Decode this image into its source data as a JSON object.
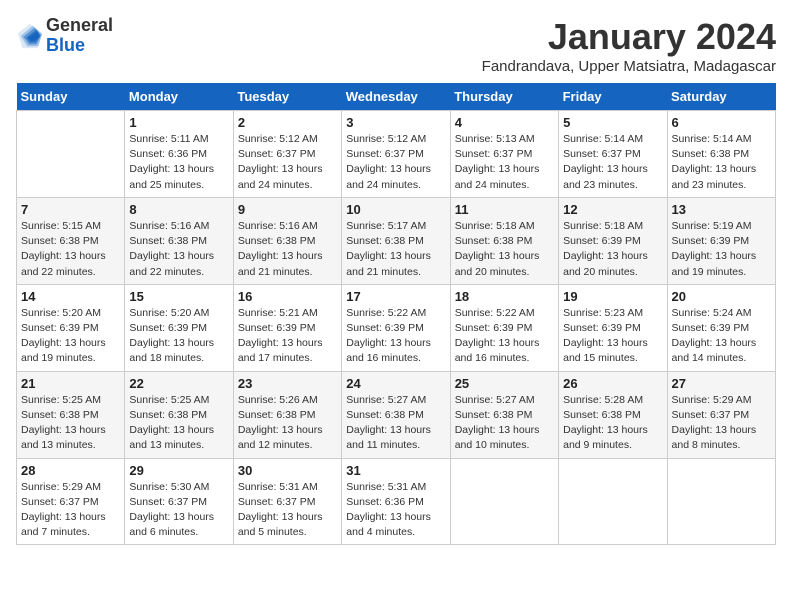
{
  "header": {
    "logo_general": "General",
    "logo_blue": "Blue",
    "month_title": "January 2024",
    "subtitle": "Fandrandava, Upper Matsiatra, Madagascar"
  },
  "days_of_week": [
    "Sunday",
    "Monday",
    "Tuesday",
    "Wednesday",
    "Thursday",
    "Friday",
    "Saturday"
  ],
  "weeks": [
    [
      {
        "day": "",
        "sunrise": "",
        "sunset": "",
        "daylight": ""
      },
      {
        "day": "1",
        "sunrise": "Sunrise: 5:11 AM",
        "sunset": "Sunset: 6:36 PM",
        "daylight": "Daylight: 13 hours and 25 minutes."
      },
      {
        "day": "2",
        "sunrise": "Sunrise: 5:12 AM",
        "sunset": "Sunset: 6:37 PM",
        "daylight": "Daylight: 13 hours and 24 minutes."
      },
      {
        "day": "3",
        "sunrise": "Sunrise: 5:12 AM",
        "sunset": "Sunset: 6:37 PM",
        "daylight": "Daylight: 13 hours and 24 minutes."
      },
      {
        "day": "4",
        "sunrise": "Sunrise: 5:13 AM",
        "sunset": "Sunset: 6:37 PM",
        "daylight": "Daylight: 13 hours and 24 minutes."
      },
      {
        "day": "5",
        "sunrise": "Sunrise: 5:14 AM",
        "sunset": "Sunset: 6:37 PM",
        "daylight": "Daylight: 13 hours and 23 minutes."
      },
      {
        "day": "6",
        "sunrise": "Sunrise: 5:14 AM",
        "sunset": "Sunset: 6:38 PM",
        "daylight": "Daylight: 13 hours and 23 minutes."
      }
    ],
    [
      {
        "day": "7",
        "sunrise": "Sunrise: 5:15 AM",
        "sunset": "Sunset: 6:38 PM",
        "daylight": "Daylight: 13 hours and 22 minutes."
      },
      {
        "day": "8",
        "sunrise": "Sunrise: 5:16 AM",
        "sunset": "Sunset: 6:38 PM",
        "daylight": "Daylight: 13 hours and 22 minutes."
      },
      {
        "day": "9",
        "sunrise": "Sunrise: 5:16 AM",
        "sunset": "Sunset: 6:38 PM",
        "daylight": "Daylight: 13 hours and 21 minutes."
      },
      {
        "day": "10",
        "sunrise": "Sunrise: 5:17 AM",
        "sunset": "Sunset: 6:38 PM",
        "daylight": "Daylight: 13 hours and 21 minutes."
      },
      {
        "day": "11",
        "sunrise": "Sunrise: 5:18 AM",
        "sunset": "Sunset: 6:38 PM",
        "daylight": "Daylight: 13 hours and 20 minutes."
      },
      {
        "day": "12",
        "sunrise": "Sunrise: 5:18 AM",
        "sunset": "Sunset: 6:39 PM",
        "daylight": "Daylight: 13 hours and 20 minutes."
      },
      {
        "day": "13",
        "sunrise": "Sunrise: 5:19 AM",
        "sunset": "Sunset: 6:39 PM",
        "daylight": "Daylight: 13 hours and 19 minutes."
      }
    ],
    [
      {
        "day": "14",
        "sunrise": "Sunrise: 5:20 AM",
        "sunset": "Sunset: 6:39 PM",
        "daylight": "Daylight: 13 hours and 19 minutes."
      },
      {
        "day": "15",
        "sunrise": "Sunrise: 5:20 AM",
        "sunset": "Sunset: 6:39 PM",
        "daylight": "Daylight: 13 hours and 18 minutes."
      },
      {
        "day": "16",
        "sunrise": "Sunrise: 5:21 AM",
        "sunset": "Sunset: 6:39 PM",
        "daylight": "Daylight: 13 hours and 17 minutes."
      },
      {
        "day": "17",
        "sunrise": "Sunrise: 5:22 AM",
        "sunset": "Sunset: 6:39 PM",
        "daylight": "Daylight: 13 hours and 16 minutes."
      },
      {
        "day": "18",
        "sunrise": "Sunrise: 5:22 AM",
        "sunset": "Sunset: 6:39 PM",
        "daylight": "Daylight: 13 hours and 16 minutes."
      },
      {
        "day": "19",
        "sunrise": "Sunrise: 5:23 AM",
        "sunset": "Sunset: 6:39 PM",
        "daylight": "Daylight: 13 hours and 15 minutes."
      },
      {
        "day": "20",
        "sunrise": "Sunrise: 5:24 AM",
        "sunset": "Sunset: 6:39 PM",
        "daylight": "Daylight: 13 hours and 14 minutes."
      }
    ],
    [
      {
        "day": "21",
        "sunrise": "Sunrise: 5:25 AM",
        "sunset": "Sunset: 6:38 PM",
        "daylight": "Daylight: 13 hours and 13 minutes."
      },
      {
        "day": "22",
        "sunrise": "Sunrise: 5:25 AM",
        "sunset": "Sunset: 6:38 PM",
        "daylight": "Daylight: 13 hours and 13 minutes."
      },
      {
        "day": "23",
        "sunrise": "Sunrise: 5:26 AM",
        "sunset": "Sunset: 6:38 PM",
        "daylight": "Daylight: 13 hours and 12 minutes."
      },
      {
        "day": "24",
        "sunrise": "Sunrise: 5:27 AM",
        "sunset": "Sunset: 6:38 PM",
        "daylight": "Daylight: 13 hours and 11 minutes."
      },
      {
        "day": "25",
        "sunrise": "Sunrise: 5:27 AM",
        "sunset": "Sunset: 6:38 PM",
        "daylight": "Daylight: 13 hours and 10 minutes."
      },
      {
        "day": "26",
        "sunrise": "Sunrise: 5:28 AM",
        "sunset": "Sunset: 6:38 PM",
        "daylight": "Daylight: 13 hours and 9 minutes."
      },
      {
        "day": "27",
        "sunrise": "Sunrise: 5:29 AM",
        "sunset": "Sunset: 6:37 PM",
        "daylight": "Daylight: 13 hours and 8 minutes."
      }
    ],
    [
      {
        "day": "28",
        "sunrise": "Sunrise: 5:29 AM",
        "sunset": "Sunset: 6:37 PM",
        "daylight": "Daylight: 13 hours and 7 minutes."
      },
      {
        "day": "29",
        "sunrise": "Sunrise: 5:30 AM",
        "sunset": "Sunset: 6:37 PM",
        "daylight": "Daylight: 13 hours and 6 minutes."
      },
      {
        "day": "30",
        "sunrise": "Sunrise: 5:31 AM",
        "sunset": "Sunset: 6:37 PM",
        "daylight": "Daylight: 13 hours and 5 minutes."
      },
      {
        "day": "31",
        "sunrise": "Sunrise: 5:31 AM",
        "sunset": "Sunset: 6:36 PM",
        "daylight": "Daylight: 13 hours and 4 minutes."
      },
      {
        "day": "",
        "sunrise": "",
        "sunset": "",
        "daylight": ""
      },
      {
        "day": "",
        "sunrise": "",
        "sunset": "",
        "daylight": ""
      },
      {
        "day": "",
        "sunrise": "",
        "sunset": "",
        "daylight": ""
      }
    ]
  ]
}
